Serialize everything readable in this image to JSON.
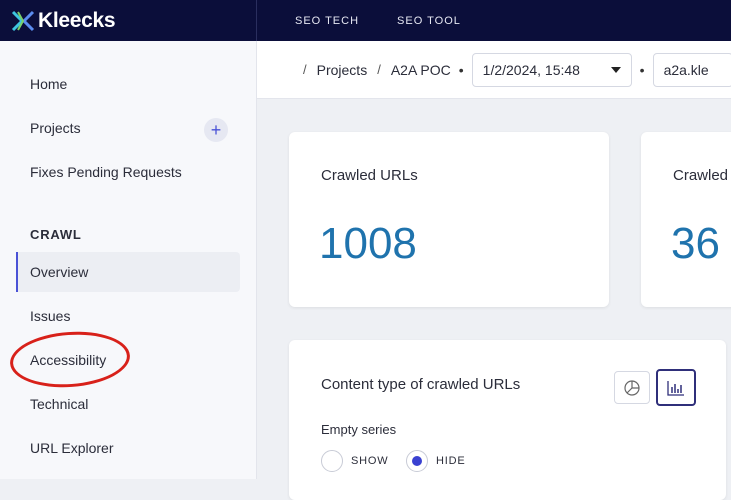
{
  "brand": {
    "name": "Kleecks"
  },
  "topnav": [
    "SEO TECH",
    "SEO TOOL"
  ],
  "sidebar": {
    "items": [
      {
        "label": "Home"
      },
      {
        "label": "Projects"
      },
      {
        "label": "Fixes Pending Requests"
      }
    ],
    "add_symbol": "+",
    "section": "CRAWL",
    "crawl_items": [
      {
        "label": "Overview",
        "active": true
      },
      {
        "label": "Issues"
      },
      {
        "label": "Accessibility",
        "highlighted": true
      },
      {
        "label": "Technical"
      },
      {
        "label": "URL Explorer"
      }
    ]
  },
  "breadcrumb": {
    "items": [
      "Projects",
      "A2A POC"
    ],
    "date": "1/2/2024, 15:48",
    "domain": "a2a.kle"
  },
  "cards": [
    {
      "title": "Crawled URLs",
      "value": "1008"
    },
    {
      "title": "Crawled",
      "value": "36"
    }
  ],
  "chart_panel": {
    "title": "Content type of crawled URLs",
    "empty_series_label": "Empty series",
    "options": [
      {
        "label": "SHOW",
        "selected": false
      },
      {
        "label": "HIDE",
        "selected": true
      }
    ]
  },
  "colors": {
    "accent": "#3a41d1",
    "value_blue": "#1f73ad",
    "topbar": "#0b0e3a",
    "annotation": "#d8211a"
  },
  "icons": [
    "home-icon",
    "pie-chart-icon",
    "bar-chart-icon",
    "caret-down-icon",
    "plus-icon"
  ]
}
